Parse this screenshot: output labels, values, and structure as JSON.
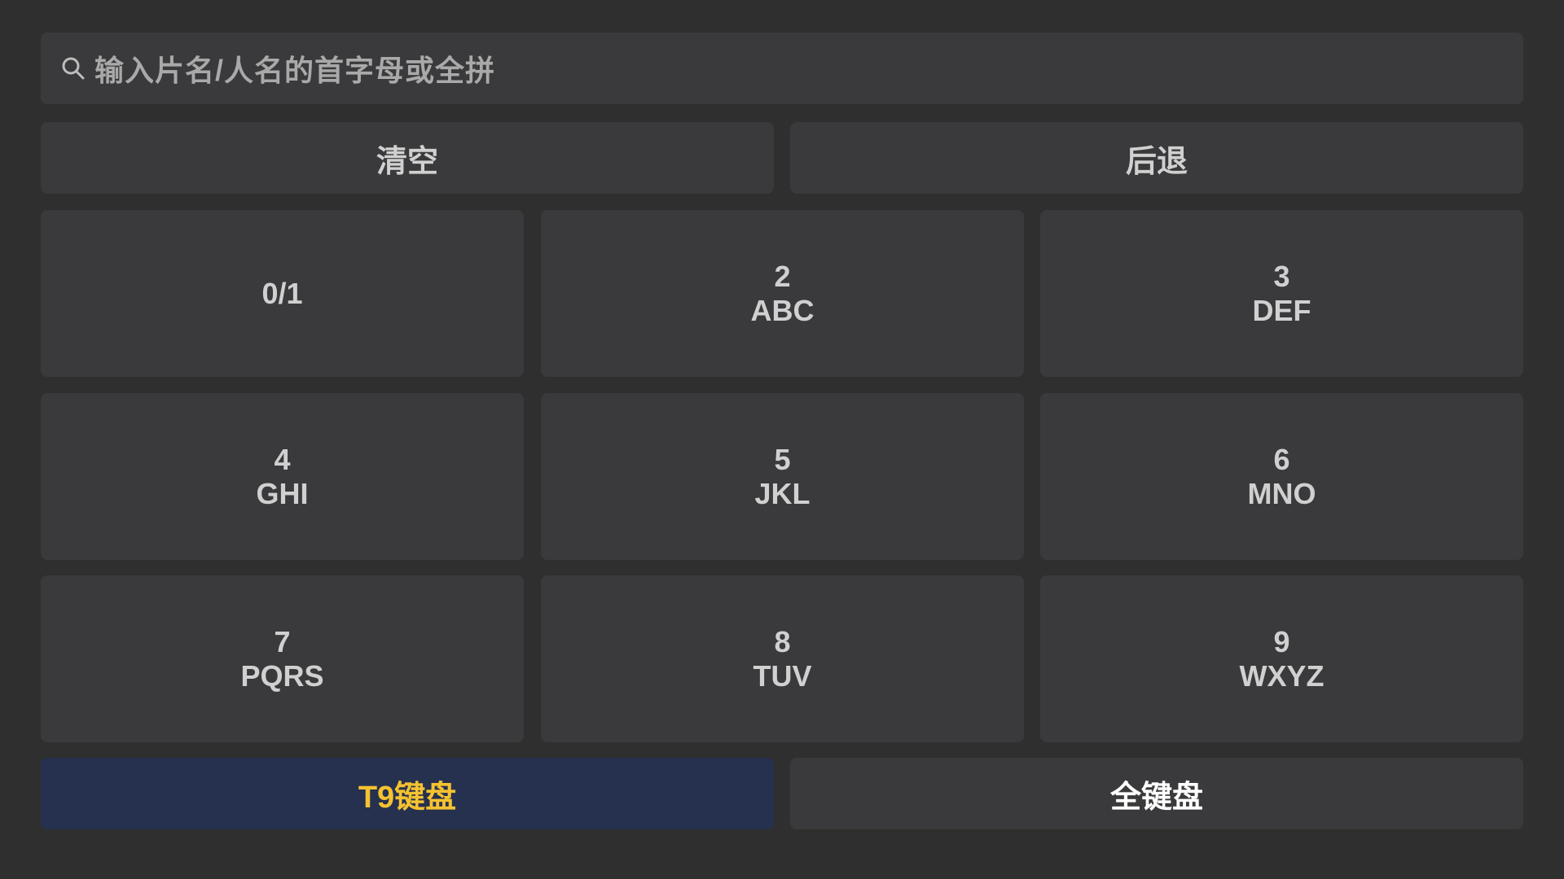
{
  "search": {
    "placeholder": "输入片名/人名的首字母或全拼",
    "icon": "search-icon"
  },
  "actions": {
    "clear_label": "清空",
    "backspace_label": "后退"
  },
  "keypad": {
    "keys": [
      {
        "digit": "",
        "letters": "0/1"
      },
      {
        "digit": "2",
        "letters": "ABC"
      },
      {
        "digit": "3",
        "letters": "DEF"
      },
      {
        "digit": "4",
        "letters": "GHI"
      },
      {
        "digit": "5",
        "letters": "JKL"
      },
      {
        "digit": "6",
        "letters": "MNO"
      },
      {
        "digit": "7",
        "letters": "PQRS"
      },
      {
        "digit": "8",
        "letters": "TUV"
      },
      {
        "digit": "9",
        "letters": "WXYZ"
      }
    ]
  },
  "modes": {
    "t9_label": "T9键盘",
    "full_label": "全键盘",
    "active": "t9"
  },
  "colors": {
    "background": "#2f2f2f",
    "key": "#3a3a3c",
    "active_mode_bg": "#26314f",
    "active_mode_text": "#f5c230"
  }
}
